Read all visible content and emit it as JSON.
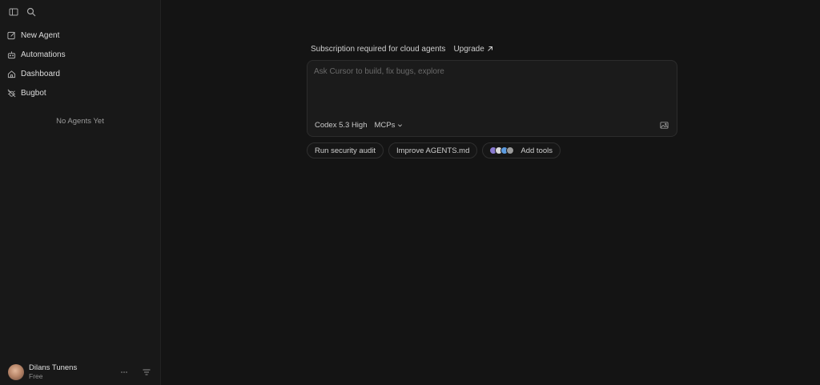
{
  "sidebar": {
    "items": [
      {
        "label": "New Agent",
        "icon": "edit-icon"
      },
      {
        "label": "Automations",
        "icon": "robot-icon"
      },
      {
        "label": "Dashboard",
        "icon": "home-icon"
      },
      {
        "label": "Bugbot",
        "icon": "bug-off-icon"
      }
    ],
    "empty_text": "No Agents Yet",
    "user": {
      "name": "Dilans Tunens",
      "plan": "Free"
    }
  },
  "main": {
    "subscription_text": "Subscription required for cloud agents",
    "upgrade_label": "Upgrade",
    "prompt_placeholder": "Ask Cursor to build, fix bugs, explore",
    "model_label": "Codex 5.3 High",
    "mcp_label": "MCPs",
    "chips": [
      "Run security audit",
      "Improve AGENTS.md",
      "Add tools"
    ]
  },
  "colors": {
    "background": "#141414",
    "sidebar": "#181818",
    "composer": "#1b1b1b",
    "tool_dots": [
      "#8a7bd1",
      "#d9d9d9",
      "#5c9be0",
      "#9a9a9a"
    ]
  }
}
